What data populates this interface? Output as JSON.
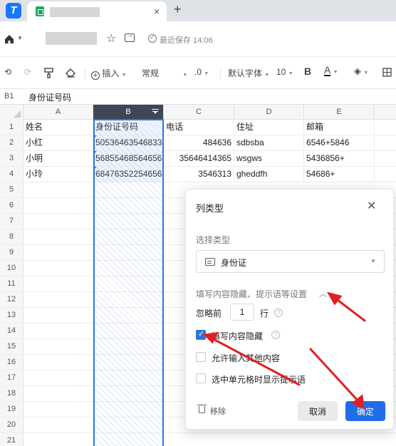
{
  "browser": {
    "new_tab": "+",
    "close": "×",
    "tab_title": ""
  },
  "titlebar": {
    "doc_title": "",
    "save_status": "最近保存 14:06"
  },
  "toolbar": {
    "undo": "⟲",
    "redo": "⟳",
    "insert": "插入",
    "format": "常规",
    "decimal": ".0",
    "font": "默认字体",
    "font_size": "10",
    "bold": "B",
    "font_color": "A"
  },
  "formula_bar": {
    "cell_ref": "B1",
    "content": "身份证号码"
  },
  "grid": {
    "columns": [
      "A",
      "B",
      "C",
      "D",
      "E"
    ],
    "row_numbers": [
      "1",
      "2",
      "3",
      "4",
      "5",
      "6",
      "7",
      "8",
      "9",
      "10",
      "11",
      "12",
      "13",
      "14",
      "15",
      "16",
      "17",
      "18",
      "19",
      "20",
      "21"
    ],
    "rows": [
      [
        "姓名",
        "身份证号码",
        "电话",
        "住址",
        "邮箱"
      ],
      [
        "小红",
        "50536463546833",
        "484636",
        "sdbsba",
        "6546+5846"
      ],
      [
        "小明",
        "56855468564656",
        "35646414365",
        "wsgws",
        "5436856+"
      ],
      [
        "小玲",
        "68476352254656",
        "3546313",
        "gheddfh",
        "54686+"
      ]
    ]
  },
  "dialog": {
    "title": "列类型",
    "select_label": "选择类型",
    "select_value": "身份证",
    "section_title": "填写内容隐藏、提示语等设置",
    "ignore_prefix": "忽略前",
    "ignore_value": "1",
    "ignore_suffix": "行",
    "options": [
      {
        "label": "填写内容隐藏",
        "checked": true
      },
      {
        "label": "允许输入其他内容",
        "checked": false
      },
      {
        "label": "选中单元格时显示提示语",
        "checked": false
      }
    ],
    "remove_label": "移除",
    "cancel_label": "取消",
    "ok_label": "确定"
  },
  "colors": {
    "accent": "#2e75d6",
    "primary_button": "#1f6ee8",
    "annotation": "#e02020",
    "selected_header": "#3e4756"
  }
}
